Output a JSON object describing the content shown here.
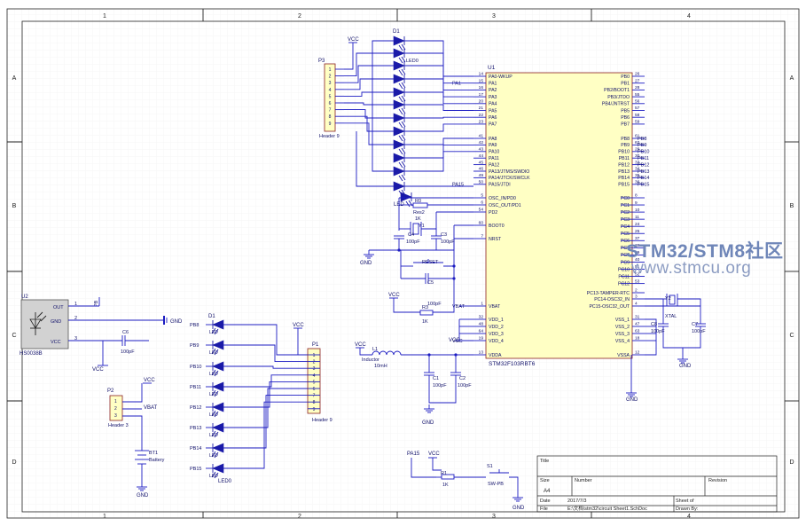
{
  "frame": {
    "col_labels": [
      "1",
      "2",
      "3",
      "4"
    ],
    "row_labels": [
      "A",
      "B",
      "C",
      "D"
    ]
  },
  "watermark": {
    "title": "STM32/STM8社区",
    "url": "www.stmcu.org"
  },
  "title_block": {
    "title_label": "Title",
    "size_label": "Size",
    "size_value": "A4",
    "number_label": "Number",
    "revision_label": "Revision",
    "date_label": "Date",
    "date_value": "2017/7/3",
    "file_label": "File",
    "file_value": "E:\\文档\\stm32\\circuit Sheet1.SchDoc",
    "sheet_label": "Sheet of",
    "drawn_label": "Drawn By:"
  },
  "mcu": {
    "designator": "U1",
    "part": "STM32F103RBT6",
    "left_pins": [
      {
        "num": "14",
        "name": "PA0-WKUP",
        "net": ""
      },
      {
        "num": "15",
        "name": "PA1",
        "net": "PA1"
      },
      {
        "num": "16",
        "name": "PA2",
        "net": ""
      },
      {
        "num": "17",
        "name": "PA3",
        "net": ""
      },
      {
        "num": "20",
        "name": "PA4",
        "net": ""
      },
      {
        "num": "21",
        "name": "PA5",
        "net": ""
      },
      {
        "num": "22",
        "name": "PA6",
        "net": ""
      },
      {
        "num": "23",
        "name": "PA7",
        "net": ""
      },
      {
        "num": "41",
        "name": "PA8",
        "net": ""
      },
      {
        "num": "42",
        "name": "PA9",
        "net": ""
      },
      {
        "num": "43",
        "name": "PA10",
        "net": ""
      },
      {
        "num": "44",
        "name": "PA11",
        "net": ""
      },
      {
        "num": "45",
        "name": "PA12",
        "net": ""
      },
      {
        "num": "46",
        "name": "PA13/JTMS/SWDIO",
        "net": ""
      },
      {
        "num": "49",
        "name": "PA14/JTCK/SWCLK",
        "net": ""
      },
      {
        "num": "50",
        "name": "PA15/JTDI",
        "net": "PA15"
      },
      {
        "num": "5",
        "name": "OSC_IN/PD0",
        "net": ""
      },
      {
        "num": "6",
        "name": "OSC_OUT/PD1",
        "net": ""
      },
      {
        "num": "54",
        "name": "PD2",
        "net": ""
      },
      {
        "num": "60",
        "name": "BOOT0",
        "net": ""
      },
      {
        "num": "7",
        "name": "NRST",
        "net": ""
      },
      {
        "num": "1",
        "name": "VBAT",
        "net": "VBAT"
      },
      {
        "num": "32",
        "name": "VDD_1",
        "net": ""
      },
      {
        "num": "48",
        "name": "VDD_2",
        "net": ""
      },
      {
        "num": "64",
        "name": "VDD_3",
        "net": ""
      },
      {
        "num": "19",
        "name": "VDD_4",
        "net": "VCC"
      },
      {
        "num": "13",
        "name": "VDDA",
        "net": ""
      }
    ],
    "right_pins": [
      {
        "num": "26",
        "name": "PB0",
        "net": ""
      },
      {
        "num": "27",
        "name": "PB1",
        "net": ""
      },
      {
        "num": "28",
        "name": "PB2/BOOT1",
        "net": ""
      },
      {
        "num": "55",
        "name": "PB3/JTDO",
        "net": ""
      },
      {
        "num": "56",
        "name": "PB4/JNTRST",
        "net": ""
      },
      {
        "num": "57",
        "name": "PB5",
        "net": ""
      },
      {
        "num": "58",
        "name": "PB6",
        "net": ""
      },
      {
        "num": "59",
        "name": "PB7",
        "net": ""
      },
      {
        "num": "61",
        "name": "PB8",
        "net": "PB8"
      },
      {
        "num": "62",
        "name": "PB9",
        "net": "PB9"
      },
      {
        "num": "29",
        "name": "PB10",
        "net": "PB10"
      },
      {
        "num": "30",
        "name": "PB11",
        "net": "PB11"
      },
      {
        "num": "33",
        "name": "PB12",
        "net": "PB12"
      },
      {
        "num": "34",
        "name": "PB13",
        "net": "PB13"
      },
      {
        "num": "35",
        "name": "PB14",
        "net": "PB14"
      },
      {
        "num": "36",
        "name": "PB15",
        "net": "PB15"
      },
      {
        "num": "8",
        "name": "PC0",
        "net": ""
      },
      {
        "num": "9",
        "name": "PC1",
        "net": ""
      },
      {
        "num": "10",
        "name": "PC2",
        "net": ""
      },
      {
        "num": "11",
        "name": "PC3",
        "net": ""
      },
      {
        "num": "24",
        "name": "PC4",
        "net": ""
      },
      {
        "num": "25",
        "name": "PC5",
        "net": ""
      },
      {
        "num": "37",
        "name": "PC6",
        "net": ""
      },
      {
        "num": "38",
        "name": "PC7",
        "net": ""
      },
      {
        "num": "39",
        "name": "PC8",
        "net": ""
      },
      {
        "num": "40",
        "name": "PC9",
        "net": ""
      },
      {
        "num": "51",
        "name": "PC10",
        "net": ""
      },
      {
        "num": "52",
        "name": "PC11",
        "net": ""
      },
      {
        "num": "53",
        "name": "PC12",
        "net": ""
      },
      {
        "num": "2",
        "name": "PC13-TAMPER-RTC",
        "net": ""
      },
      {
        "num": "3",
        "name": "PC14-OSC32_IN",
        "net": ""
      },
      {
        "num": "4",
        "name": "PC15-OSC32_OUT",
        "net": ""
      },
      {
        "num": "31",
        "name": "VSS_1",
        "net": ""
      },
      {
        "num": "47",
        "name": "VSS_2",
        "net": ""
      },
      {
        "num": "63",
        "name": "VSS_3",
        "net": ""
      },
      {
        "num": "18",
        "name": "VSS_4",
        "net": ""
      },
      {
        "num": "12",
        "name": "VSSA",
        "net": ""
      }
    ]
  },
  "leds_top": {
    "ref_first": "D1",
    "ref_last": "LED0",
    "ref_bottom": "LED"
  },
  "p3": {
    "designator": "P3",
    "label": "Header 9",
    "pins": [
      "1",
      "2",
      "3",
      "4",
      "5",
      "6",
      "7",
      "8",
      "9"
    ]
  },
  "p1": {
    "designator": "P1",
    "label": "Header 9",
    "pins": [
      "1",
      "2",
      "3",
      "4",
      "5",
      "6",
      "7",
      "8",
      "9"
    ]
  },
  "leds_bottom": {
    "ref_first": "D1",
    "ref_last": "LED0",
    "nets": [
      "PB8",
      "PB9",
      "PB10",
      "PB11",
      "PB12",
      "PB13",
      "PB14",
      "PB15"
    ],
    "led_label": "LED"
  },
  "u2": {
    "designator": "U2",
    "part": "HS0038B",
    "pins": [
      "OUT",
      "GND",
      "VCC"
    ],
    "pin_nums": [
      "1",
      "2",
      "3"
    ],
    "net_out": "PB",
    "c6": "C6",
    "c6_val": "100pF"
  },
  "p2": {
    "designator": "P2",
    "label": "Header 3",
    "pins": [
      "1",
      "2",
      "3"
    ],
    "net": "VBAT"
  },
  "bt1": {
    "designator": "BT1",
    "label": "Battery"
  },
  "misc": {
    "vcc": "VCC",
    "gnd": "GND",
    "r0": "R0",
    "rp2": "Res2",
    "rp2_val": "1K",
    "y1": "Y1",
    "c4": "C4",
    "c4_val": "100pF",
    "c3": "C3",
    "c3_val": "100pF",
    "reset": "RESET",
    "c5": "C5",
    "c5_val": "100pF",
    "r3": "R3",
    "r3_val": "1K",
    "l1": "L1",
    "l1_type": "Inductor",
    "l1_val": "10mH",
    "c1": "C1",
    "c1_val": "100pF",
    "c2": "C2",
    "c2_val": "100pF",
    "y2": "Y2",
    "xtal": "XTAL",
    "c8": "C8",
    "c8_val": "100pF",
    "c7": "C7",
    "c7_val": "100pF",
    "pa15": "PA15",
    "r1": "R1",
    "r1_val": "1K",
    "s1": "S1",
    "sw_pb": "SW-PB"
  },
  "colors": {
    "wire": "#1c1cc2",
    "part_body": "#ffffc4",
    "part_border": "#8b2020",
    "text": "#10106a",
    "frame": "#222222",
    "led": "#1a1aa8"
  }
}
